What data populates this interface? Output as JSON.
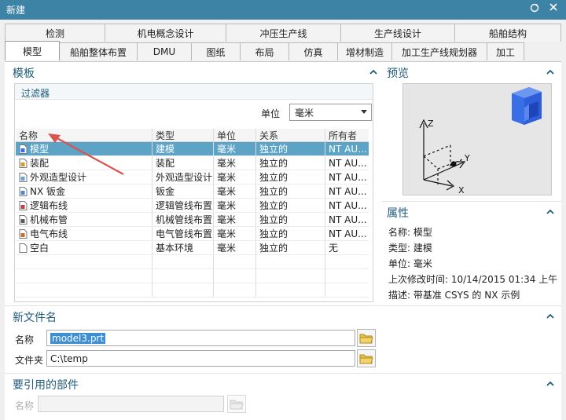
{
  "window": {
    "title": "新建"
  },
  "tabs": {
    "row1": [
      "检测",
      "机电概念设计",
      "冲压生产线",
      "生产线设计",
      "船舶结构"
    ],
    "row2": [
      "模型",
      "船舶整体布置",
      "DMU",
      "图纸",
      "布局",
      "仿真",
      "增材制造",
      "加工生产线规划器",
      "加工"
    ],
    "active": "模型"
  },
  "template": {
    "title": "模板",
    "filter_title": "过滤器",
    "unit_label": "单位",
    "unit_value": "毫米",
    "columns": [
      "名称",
      "类型",
      "单位",
      "关系",
      "所有者"
    ],
    "rows": [
      {
        "name": "模型",
        "type": "建模",
        "unit": "毫米",
        "relation": "独立的",
        "owner": "NT AU...",
        "icon": "model-file-icon",
        "selected": true
      },
      {
        "name": "装配",
        "type": "装配",
        "unit": "毫米",
        "relation": "独立的",
        "owner": "NT AU...",
        "icon": "assembly-file-icon"
      },
      {
        "name": "外观造型设计",
        "type": "外观造型设计",
        "unit": "毫米",
        "relation": "独立的",
        "owner": "NT AU...",
        "icon": "shape-design-file-icon"
      },
      {
        "name": "NX 钣金",
        "type": "钣金",
        "unit": "毫米",
        "relation": "独立的",
        "owner": "NT AU...",
        "icon": "sheet-metal-file-icon"
      },
      {
        "name": "逻辑布线",
        "type": "逻辑管线布置",
        "unit": "毫米",
        "relation": "独立的",
        "owner": "NT AU...",
        "icon": "logic-routing-file-icon"
      },
      {
        "name": "机械布管",
        "type": "机械管线布置",
        "unit": "毫米",
        "relation": "独立的",
        "owner": "NT AU...",
        "icon": "mech-routing-file-icon"
      },
      {
        "name": "电气布线",
        "type": "电气管线布置",
        "unit": "毫米",
        "relation": "独立的",
        "owner": "NT AU...",
        "icon": "elec-routing-file-icon"
      },
      {
        "name": "空白",
        "type": "基本环境",
        "unit": "毫米",
        "relation": "独立的",
        "owner": "无",
        "icon": "blank-file-icon"
      }
    ]
  },
  "preview": {
    "title": "预览",
    "axis_labels": {
      "z": "Z",
      "y": "Y",
      "x": "X"
    }
  },
  "properties": {
    "title": "属性",
    "name": "名称:  模型",
    "type": "类型:  建模",
    "unit": "单位:  毫米",
    "modified": "上次修改时间:    10/14/2015 01:34 上午",
    "description": "描述:   带基准 CSYS 的 NX 示例"
  },
  "new_file": {
    "title": "新文件名",
    "name_label": "名称",
    "name_value": "model3.prt",
    "folder_label": "文件夹",
    "folder_value": "C:\\temp"
  },
  "referenced": {
    "title": "要引用的部件",
    "name_label": "名称",
    "name_value": ""
  },
  "colors": {
    "titlebar": "#3d83a6",
    "section_text": "#1f5b7a",
    "selection": "#5ca3c6",
    "arrow": "#d9534f"
  }
}
